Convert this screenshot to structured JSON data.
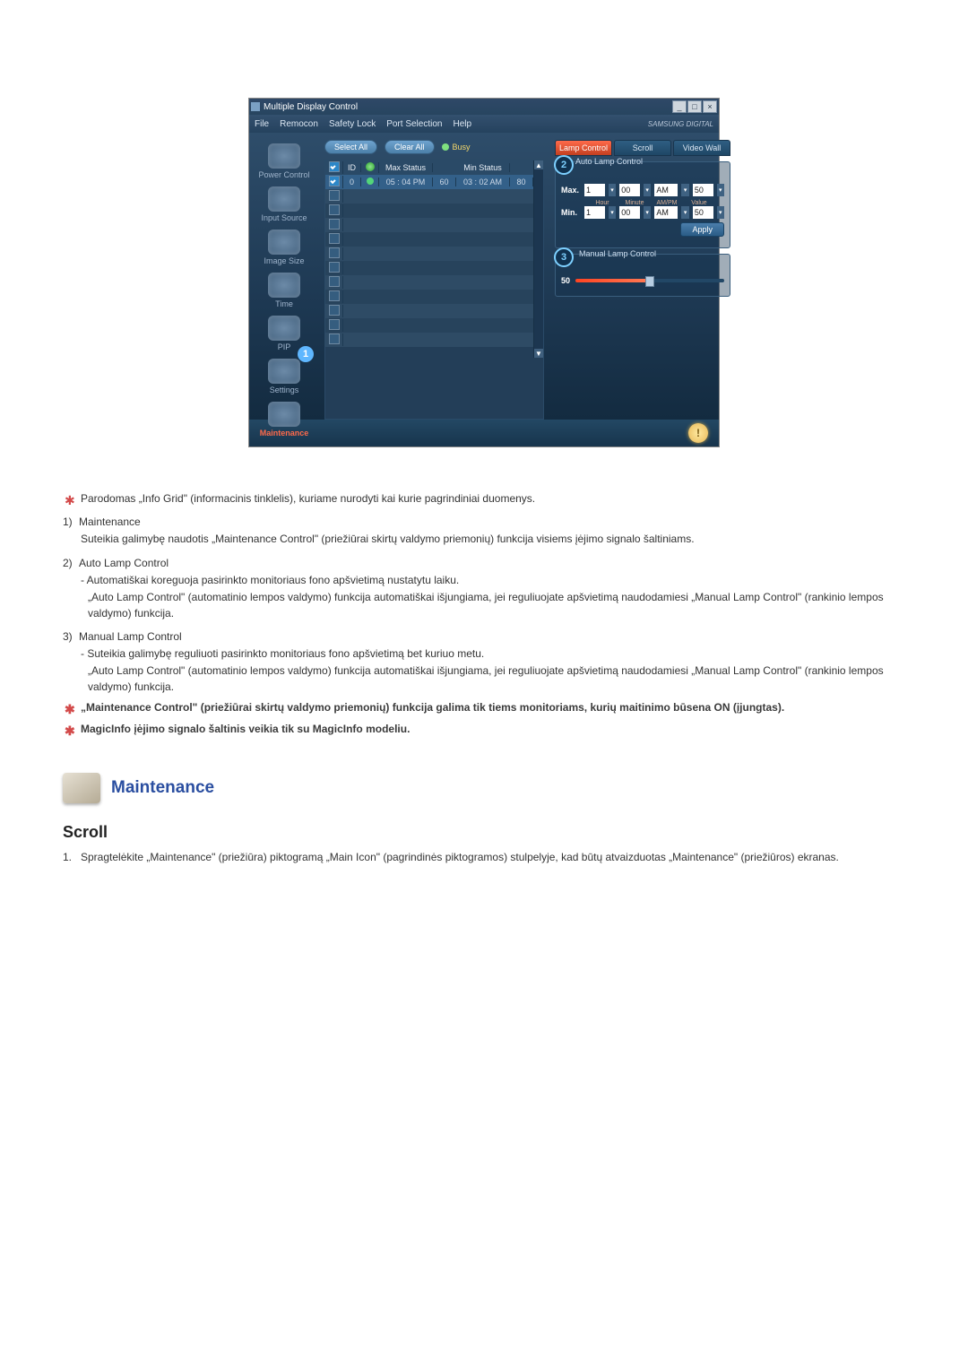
{
  "app": {
    "title": "Multiple Display Control",
    "menu": {
      "file": "File",
      "remocon": "Remocon",
      "safety_lock": "Safety Lock",
      "port_selection": "Port Selection",
      "help": "Help"
    },
    "brand": "SAMSUNG DIGITAL"
  },
  "sidebar": {
    "items": [
      {
        "label": "Power Control"
      },
      {
        "label": "Input Source"
      },
      {
        "label": "Image Size"
      },
      {
        "label": "Time"
      },
      {
        "label": "PIP"
      },
      {
        "label": "Settings"
      },
      {
        "label": "Maintenance"
      }
    ],
    "badge1": "1"
  },
  "toolbar": {
    "select_all": "Select All",
    "clear_all": "Clear All",
    "busy": "Busy"
  },
  "grid": {
    "headers": {
      "id": "ID",
      "max_status": "Max Status",
      "min_status": "Min Status"
    },
    "row1": {
      "id": "0",
      "max_time": "05 : 04 PM",
      "max_val": "60",
      "min_time": "03 : 02 AM",
      "min_val": "80"
    }
  },
  "panel": {
    "tabs": {
      "lamp": "Lamp Control",
      "scroll": "Scroll",
      "video": "Video Wall"
    },
    "badge2": "2",
    "badge3": "3",
    "auto_title": "Auto Lamp Control",
    "manual_title": "Manual Lamp Control",
    "max": "Max.",
    "min": "Min.",
    "hour": "1",
    "minute": "00",
    "ampm": "AM",
    "value": "50",
    "sub": {
      "hour": "Hour",
      "minute": "Minute",
      "ampm": "AM/PM",
      "value": "Value"
    },
    "apply": "Apply",
    "manual_value": "50"
  },
  "status_icon": "!",
  "doc": {
    "star1": "Parodomas „Info Grid\" (informacinis tinklelis), kuriame nurodyti kai kurie pagrindiniai duomenys.",
    "n1_title": "Maintenance",
    "n1_p1": "Suteikia galimybę naudotis „Maintenance Control\" (priežiūrai skirtų valdymo priemonių) funkcija visiems įėjimo signalo šaltiniams.",
    "n2_title": "Auto Lamp Control",
    "n2_b1": "Automatiškai koreguoja pasirinkto monitoriaus fono apšvietimą nustatytu laiku.",
    "n2_p1": "„Auto Lamp Control\" (automatinio lempos valdymo) funkcija automatiškai išjungiama, jei reguliuojate apšvietimą naudodamiesi „Manual Lamp Control\" (rankinio lempos valdymo) funkcija.",
    "n3_title": "Manual Lamp Control",
    "n3_b1": "Suteikia galimybę reguliuoti pasirinkto monitoriaus fono apšvietimą bet kuriuo metu.",
    "n3_p1": "„Auto Lamp Control\" (automatinio lempos valdymo) funkcija automatiškai išjungiama, jei reguliuojate apšvietimą naudodamiesi „Manual Lamp Control\" (rankinio lempos valdymo) funkcija.",
    "note1": "„Maintenance Control\" (priežiūrai skirtų valdymo priemonių) funkcija galima tik tiems monitoriams, kurių maitinimo būsena ON (įjungtas).",
    "note2": "MagicInfo įėjimo signalo šaltinis veikia tik su MagicInfo modeliu.",
    "section_title": "Maintenance",
    "sub_heading": "Scroll",
    "ol1": "Spragtelėkite „Maintenance\" (priežiūra) piktogramą „Main Icon\" (pagrindinės piktogramos) stulpelyje, kad būtų atvaizduotas „Maintenance\" (priežiūros) ekranas."
  }
}
